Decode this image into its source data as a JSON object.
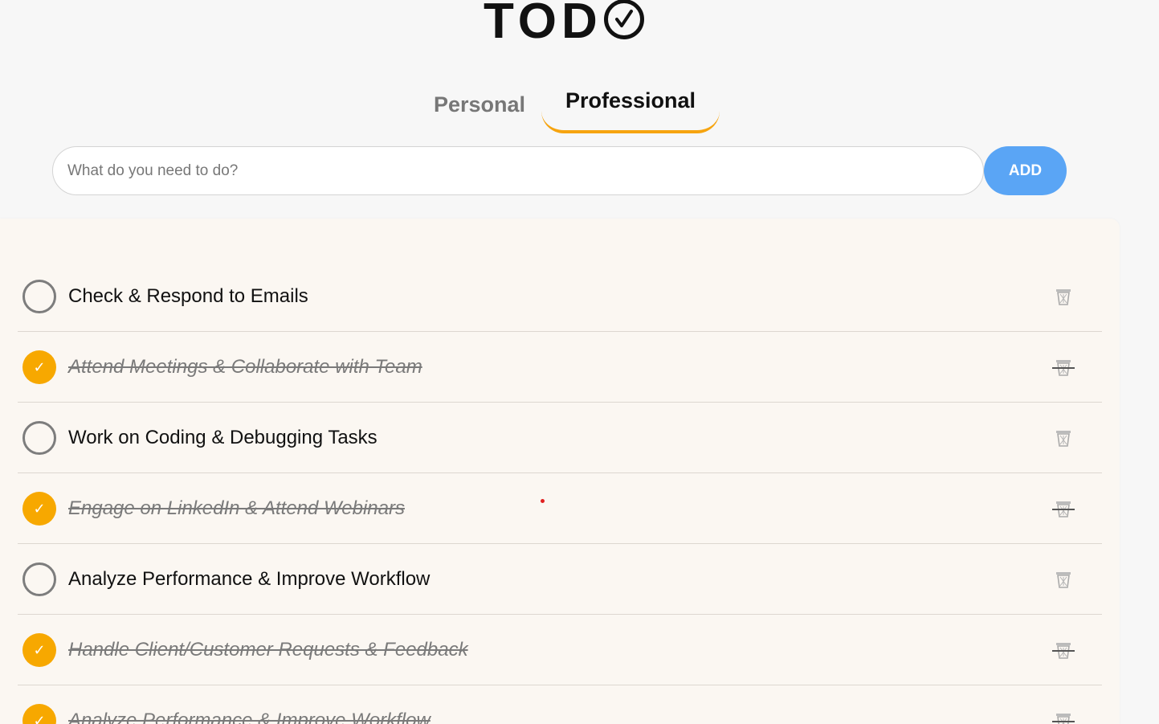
{
  "logo": {
    "text": "TOD",
    "icon": "check-circle-icon"
  },
  "tabs": [
    {
      "label": "Personal",
      "active": false
    },
    {
      "label": "Professional",
      "active": true
    }
  ],
  "input": {
    "placeholder": "What do you need to do?",
    "value": ""
  },
  "add_button": {
    "label": "ADD"
  },
  "colors": {
    "accent": "#f7a800",
    "add_button": "#5aa5f5",
    "tab_underline": "#f6a410",
    "list_background": "#fbf7f2"
  },
  "tasks": [
    {
      "text": "Check & Respond to Emails",
      "done": false
    },
    {
      "text": "Attend Meetings & Collaborate with Team",
      "done": true
    },
    {
      "text": "Work on Coding & Debugging Tasks",
      "done": false
    },
    {
      "text": "Engage on LinkedIn & Attend Webinars",
      "done": true
    },
    {
      "text": "Analyze Performance & Improve Workflow",
      "done": false
    },
    {
      "text": "Handle Client/Customer Requests & Feedback",
      "done": true
    },
    {
      "text": "Analyze Performance & Improve Workflow",
      "done": true
    }
  ]
}
